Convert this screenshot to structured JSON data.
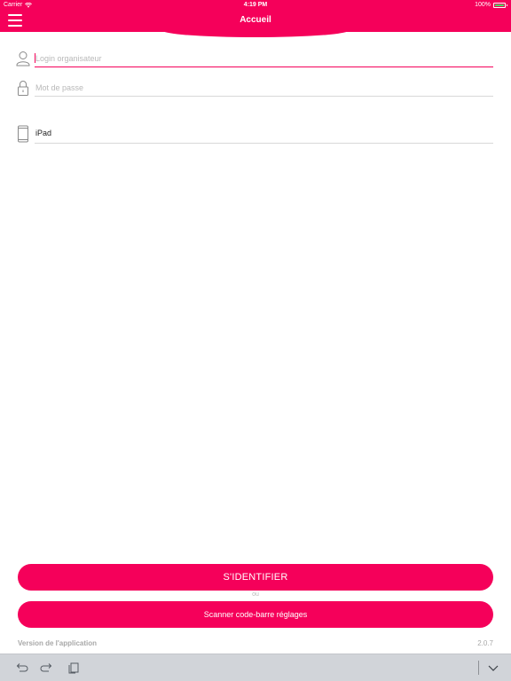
{
  "status_bar": {
    "carrier": "Carrier",
    "time": "4:19 PM",
    "battery": "100%",
    "battery_level": 1.0
  },
  "nav": {
    "title": "Accueil",
    "menu_icon": "hamburger-menu-icon"
  },
  "form": {
    "login": {
      "placeholder": "Login organisateur",
      "value": "",
      "icon": "user-icon"
    },
    "password": {
      "placeholder": "Mot de passe",
      "value": "",
      "icon": "lock-icon"
    },
    "device": {
      "value": "iPad",
      "icon": "tablet-icon"
    }
  },
  "actions": {
    "login_button": "S'IDENTIFIER",
    "separator": "ou",
    "scan_button": "Scanner code-barre réglages"
  },
  "footer": {
    "version_label": "Version de l'application",
    "version_value": "2.0.7"
  },
  "shortcut_bar": {
    "undo_icon": "undo-icon",
    "redo_icon": "redo-icon",
    "paste_icon": "paste-icon",
    "dismiss_icon": "chevron-down-icon"
  },
  "colors": {
    "accent": "#f5005a",
    "background": "#ffffff",
    "placeholder": "#b9b9b9",
    "shortcut_bar": "#d1d4d9"
  }
}
